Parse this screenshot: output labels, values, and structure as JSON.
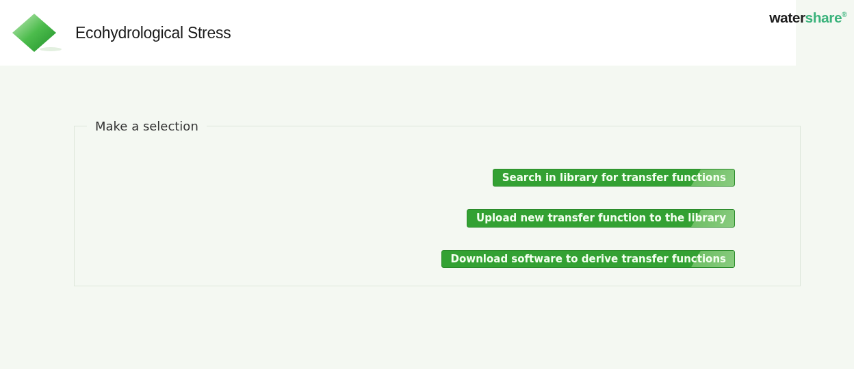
{
  "header": {
    "title": "Ecohydrological Stress",
    "brand": {
      "first": "water",
      "second": "share",
      "mark": "®"
    }
  },
  "selection": {
    "legend": "Make a selection",
    "buttons": [
      "Search in library for transfer functions",
      "Upload new transfer function to the library",
      "Download software to derive transfer functions"
    ]
  }
}
